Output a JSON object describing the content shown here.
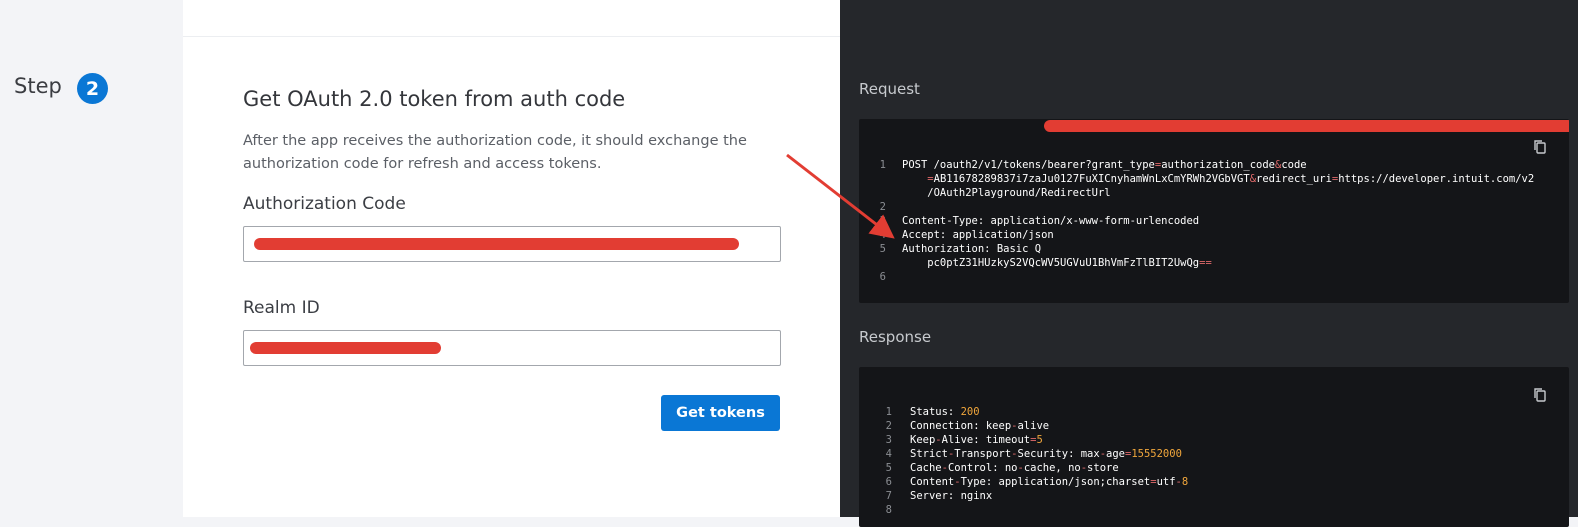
{
  "step": {
    "label": "Step",
    "number": "2"
  },
  "form": {
    "title": "Get OAuth 2.0 token from auth code",
    "description": "After the app receives the authorization code, it should exchange the authorization code for refresh and access tokens.",
    "auth_code_label": "Authorization Code",
    "realm_id_label": "Realm ID",
    "get_tokens_label": "Get tokens"
  },
  "request": {
    "label": "Request",
    "lines": [
      {
        "num": "1",
        "segments": [
          {
            "t": "POST /oauth2/v1/tokens/bearer?grant_type"
          },
          {
            "t": "=",
            "c": "op"
          },
          {
            "t": "authorization_code"
          },
          {
            "t": "&",
            "c": "op"
          },
          {
            "t": "code"
          }
        ]
      },
      {
        "num": "",
        "segments": [
          {
            "t": "    "
          },
          {
            "t": "=",
            "c": "op"
          },
          {
            "t": "AB11678289837i7zaJu0127FuXICnyhamWnLxCmYRWh2VGbVGT"
          },
          {
            "t": "&",
            "c": "op"
          },
          {
            "t": "redirect_uri"
          },
          {
            "t": "=",
            "c": "op"
          },
          {
            "t": "https://developer.intuit.com/v2"
          }
        ]
      },
      {
        "num": "",
        "segments": [
          {
            "t": "    /OAuth2Playground/RedirectUrl"
          }
        ]
      },
      {
        "num": "2",
        "segments": []
      },
      {
        "num": "3",
        "segments": [
          {
            "t": "Content-Type: application/x-www-form-urlencoded"
          }
        ]
      },
      {
        "num": "4",
        "segments": [
          {
            "t": "Accept: application/json"
          }
        ]
      },
      {
        "num": "5",
        "segments": [
          {
            "t": "Authorization: Basic Q"
          }
        ]
      },
      {
        "num": "",
        "segments": [
          {
            "t": "    pc0ptZ31HUzkyS2VQcWV5UGVuU1BhVmFzTlBIT2UwQg"
          },
          {
            "t": "==",
            "c": "op"
          }
        ]
      },
      {
        "num": "6",
        "segments": []
      }
    ]
  },
  "response": {
    "label": "Response",
    "lines": [
      {
        "num": "1",
        "segments": [
          {
            "t": "Status: "
          },
          {
            "t": "200",
            "c": "num"
          }
        ]
      },
      {
        "num": "2",
        "segments": [
          {
            "t": "Connection: keep"
          },
          {
            "t": "-",
            "c": "op"
          },
          {
            "t": "alive"
          }
        ]
      },
      {
        "num": "3",
        "segments": [
          {
            "t": "Keep"
          },
          {
            "t": "-",
            "c": "op"
          },
          {
            "t": "Alive: timeout"
          },
          {
            "t": "=",
            "c": "op"
          },
          {
            "t": "5",
            "c": "num"
          }
        ]
      },
      {
        "num": "4",
        "segments": [
          {
            "t": "Strict"
          },
          {
            "t": "-",
            "c": "op"
          },
          {
            "t": "Transport"
          },
          {
            "t": "-",
            "c": "op"
          },
          {
            "t": "Security: max"
          },
          {
            "t": "-",
            "c": "op"
          },
          {
            "t": "age"
          },
          {
            "t": "=",
            "c": "op"
          },
          {
            "t": "15552000",
            "c": "num"
          }
        ]
      },
      {
        "num": "5",
        "segments": [
          {
            "t": "Cache"
          },
          {
            "t": "-",
            "c": "op"
          },
          {
            "t": "Control: no"
          },
          {
            "t": "-",
            "c": "op"
          },
          {
            "t": "cache, no"
          },
          {
            "t": "-",
            "c": "op"
          },
          {
            "t": "store"
          }
        ]
      },
      {
        "num": "6",
        "segments": [
          {
            "t": "Content"
          },
          {
            "t": "-",
            "c": "op"
          },
          {
            "t": "Type: application/json;charset"
          },
          {
            "t": "=",
            "c": "op"
          },
          {
            "t": "utf"
          },
          {
            "t": "-",
            "c": "op"
          },
          {
            "t": "8",
            "c": "num"
          }
        ]
      },
      {
        "num": "7",
        "segments": [
          {
            "t": "Server: nginx"
          }
        ]
      },
      {
        "num": "8",
        "segments": []
      }
    ]
  },
  "icons": {
    "copy": "copy-icon",
    "annotation": "red-arrow"
  },
  "colors": {
    "accent": "#0a77d5",
    "redaction": "#e23d33",
    "dark_panel": "#25272b",
    "code_bg": "#141518"
  }
}
